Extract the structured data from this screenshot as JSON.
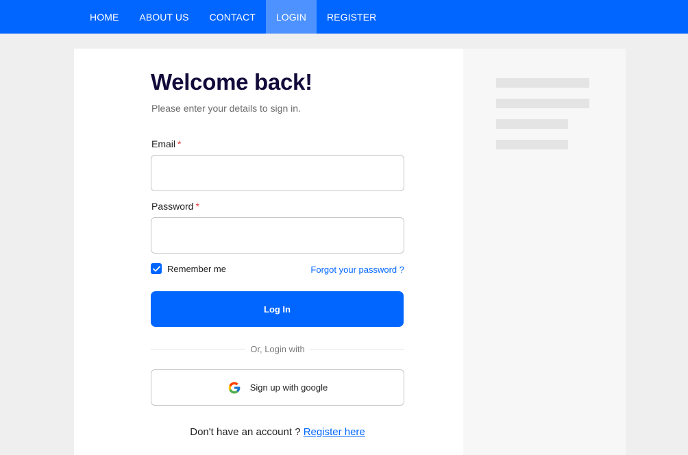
{
  "nav": {
    "items": [
      {
        "label": "HOME",
        "active": false
      },
      {
        "label": "ABOUT US",
        "active": false
      },
      {
        "label": "CONTACT",
        "active": false
      },
      {
        "label": "LOGIN",
        "active": true
      },
      {
        "label": "REGISTER",
        "active": false
      }
    ]
  },
  "login": {
    "title": "Welcome back!",
    "subtitle": "Please enter your details to sign in.",
    "email_label": "Email",
    "email_value": "",
    "password_label": "Password",
    "password_value": "",
    "required_mark": "*",
    "remember_label": "Remember me",
    "remember_checked": true,
    "forgot_label": "Forgot your password ?",
    "login_button": "Log In",
    "divider_text": "Or, Login with",
    "google_button": "Sign up with google",
    "no_account_text": "Don't have an account ?",
    "register_link": "Register here"
  },
  "colors": {
    "primary": "#0066ff",
    "nav_active": "#4d92ff",
    "title": "#120a3a",
    "required": "#e23b3b"
  }
}
